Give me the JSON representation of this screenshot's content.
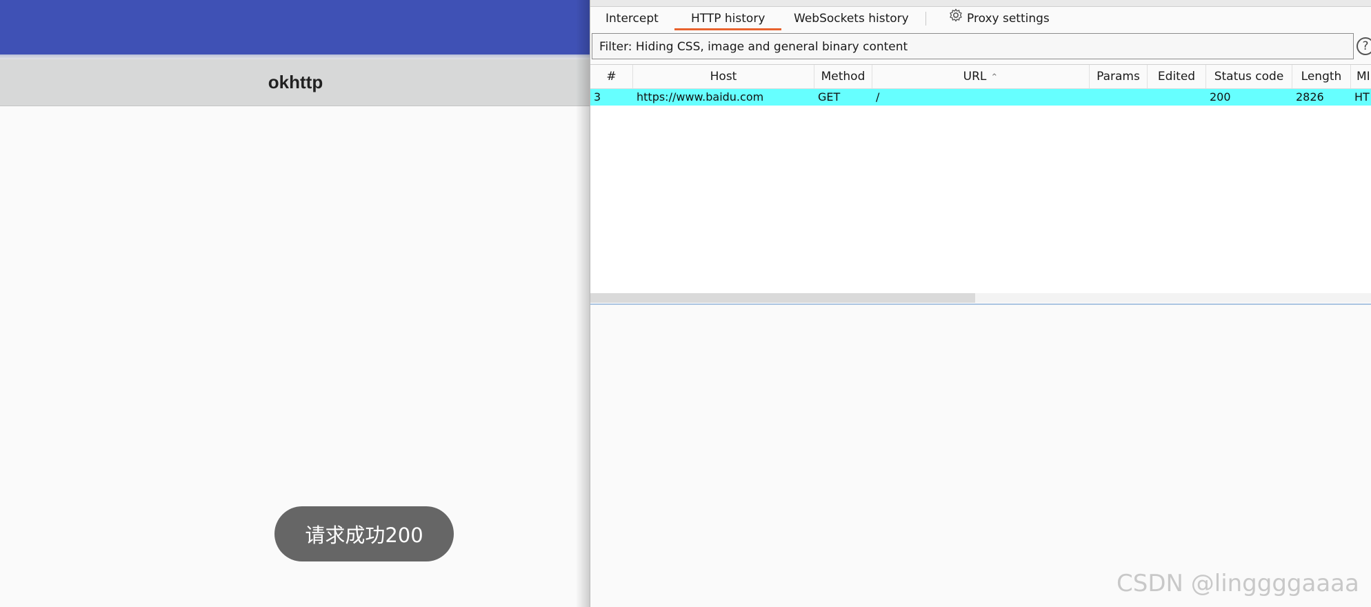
{
  "android": {
    "app_title": "okhttp",
    "toast_text": "请求成功200",
    "colors": {
      "status_bar": "#3f51b5",
      "app_bar": "#d7d8d8",
      "toast": "#666666"
    }
  },
  "burp": {
    "tabs": [
      {
        "label": "Intercept",
        "active": false
      },
      {
        "label": "HTTP history",
        "active": true
      },
      {
        "label": "WebSockets history",
        "active": false
      },
      {
        "label": "Proxy settings",
        "active": false,
        "icon": "gear-icon"
      }
    ],
    "filter_text": "Filter: Hiding CSS, image and general binary content",
    "help_symbol": "?",
    "table": {
      "columns": [
        "#",
        "Host",
        "Method",
        "URL",
        "Params",
        "Edited",
        "Status code",
        "Length",
        "MI"
      ],
      "sorted_column": "URL",
      "rows": [
        {
          "num": "3",
          "host": "https://www.baidu.com",
          "method": "GET",
          "url": "/",
          "params": "",
          "edited": "",
          "status": "200",
          "length": "2826",
          "mime": "HT"
        }
      ],
      "highlight_color": "#66ffff"
    },
    "accent_color": "#e8622d"
  },
  "watermark": "CSDN @linggggaaaa"
}
